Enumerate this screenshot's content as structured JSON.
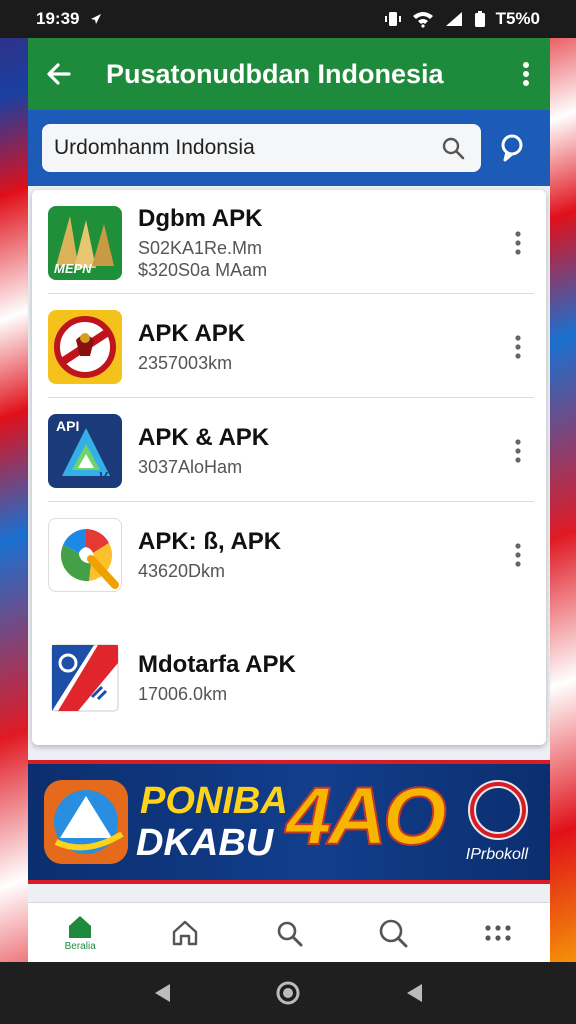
{
  "status_bar": {
    "time": "19:39",
    "battery": "T5%0"
  },
  "app_bar": {
    "title": "Pusatonudbdan Indonesia"
  },
  "search": {
    "value": "Urdomhanm Indonsia"
  },
  "apps": [
    {
      "name": "Dgbm APK",
      "meta1": "S02KA1Re.Mm",
      "meta2": "$320S0a MAam",
      "icon_text": "MEPN"
    },
    {
      "name": "APK APK",
      "meta1": "2357003km",
      "meta2": ""
    },
    {
      "name": "APK & APK",
      "meta1": "3037AloHam",
      "meta2": "",
      "icon_text": "API",
      "icon_text2": "VX"
    },
    {
      "name": "APK: ß, APK",
      "meta1": "43620Dkm",
      "meta2": ""
    },
    {
      "name": "Mdotarfa APK",
      "meta1": "17006.0km",
      "meta2": ""
    }
  ],
  "banner": {
    "line1": "PONIBA",
    "line2": "DKABU",
    "big": "4AO",
    "sub": "IPrbokoll"
  },
  "bottom_nav": {
    "home_label": "Beralia"
  },
  "colors": {
    "app_bar": "#1e8a3c",
    "search_bar": "#1d5bb8",
    "banner": "#123e8c"
  }
}
